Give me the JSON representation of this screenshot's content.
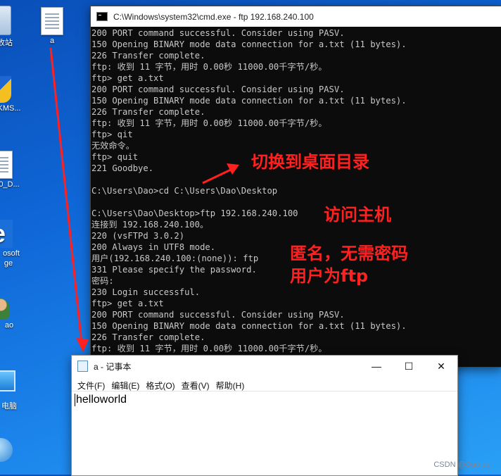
{
  "desktop": {
    "icons": [
      {
        "label": "收站"
      },
      {
        "label": "a"
      },
      {
        "label": "KMS..."
      },
      {
        "label": "0_D..."
      },
      {
        "label": "osoft"
      },
      {
        "label": "ge"
      },
      {
        "label": "ao"
      },
      {
        "label": "电脑"
      }
    ]
  },
  "cmd": {
    "title": "C:\\Windows\\system32\\cmd.exe - ftp  192.168.240.100",
    "lines": [
      "200 PORT command successful. Consider using PASV.",
      "150 Opening BINARY mode data connection for a.txt (11 bytes).",
      "226 Transfer complete.",
      "ftp: 收到 11 字节，用时 0.00秒 11000.00千字节/秒。",
      "ftp> get a.txt",
      "200 PORT command successful. Consider using PASV.",
      "150 Opening BINARY mode data connection for a.txt (11 bytes).",
      "226 Transfer complete.",
      "ftp: 收到 11 字节，用时 0.00秒 11000.00千字节/秒。",
      "ftp> qit",
      "无效命令。",
      "ftp> quit",
      "221 Goodbye.",
      "",
      "C:\\Users\\Dao>cd C:\\Users\\Dao\\Desktop",
      "",
      "C:\\Users\\Dao\\Desktop>ftp 192.168.240.100",
      "连接到 192.168.240.100。",
      "220 (vsFTPd 3.0.2)",
      "200 Always in UTF8 mode.",
      "用户(192.168.240.100:(none)): ftp",
      "331 Please specify the password.",
      "密码:",
      "230 Login successful.",
      "ftp> get a.txt",
      "200 PORT command successful. Consider using PASV.",
      "150 Opening BINARY mode data connection for a.txt (11 bytes).",
      "226 Transfer complete.",
      "ftp: 收到 11 字节，用时 0.00秒 11000.00千字节/秒。"
    ]
  },
  "annotations": {
    "switch_dir": "切换到桌面目录",
    "visit_host": "访问主机",
    "anonymous_1": "匿名，无需密码",
    "anonymous_2": "用户为ftp",
    "color": "#ff2020"
  },
  "notepad": {
    "title": "a - 记事本",
    "menus": [
      "文件(F)",
      "编辑(E)",
      "格式(O)",
      "查看(V)",
      "帮助(H)"
    ],
    "content": "helloworld",
    "controls": {
      "minimize": "—",
      "maximize": "☐",
      "close": "✕"
    }
  },
  "watermark": "CSDN @Dao.zs"
}
